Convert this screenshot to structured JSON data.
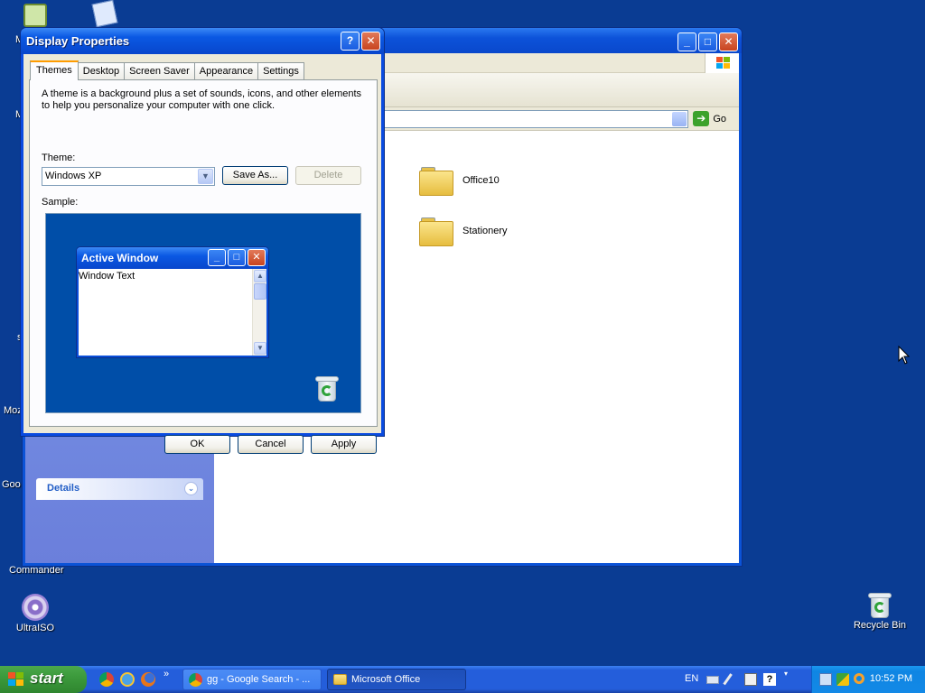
{
  "desktop": {
    "icons": {
      "ultraiso": "UltraISO",
      "recycle_bin": "Recycle Bin",
      "commander": "Commander"
    },
    "fragments": {
      "m1": "M",
      "m2": "M",
      "moz": "Moz",
      "goo": "Goo",
      "s": "s"
    }
  },
  "explorer": {
    "address_go": "Go",
    "folders": [
      "Office10",
      "Stationery"
    ],
    "details_label": "Details"
  },
  "dialog": {
    "title": "Display Properties",
    "help_glyph": "?",
    "close_glyph": "✕",
    "tabs": [
      "Themes",
      "Desktop",
      "Screen Saver",
      "Appearance",
      "Settings"
    ],
    "description": "A theme is a background plus a set of sounds, icons, and other elements to help you personalize your computer with one click.",
    "theme_label": "Theme:",
    "theme_value": "Windows XP",
    "save_as_label": "Save As...",
    "delete_label": "Delete",
    "sample_label": "Sample:",
    "sample_window": {
      "title": "Active Window",
      "text": "Window Text"
    },
    "ok_label": "OK",
    "cancel_label": "Cancel",
    "apply_label": "Apply"
  },
  "taskbar": {
    "start_label": "start",
    "quicklaunch_more": "»",
    "tasks": [
      {
        "label": "gg - Google Search - ...",
        "active": false
      },
      {
        "label": "Microsoft Office",
        "active": true
      }
    ],
    "language": "EN",
    "clock": "10:52 PM"
  },
  "colors": {
    "desktop": "#0a3c93",
    "xp_title_blue": "#0a58e3",
    "start_green": "#3c9a3c",
    "tab_highlight": "#ff9c00"
  }
}
